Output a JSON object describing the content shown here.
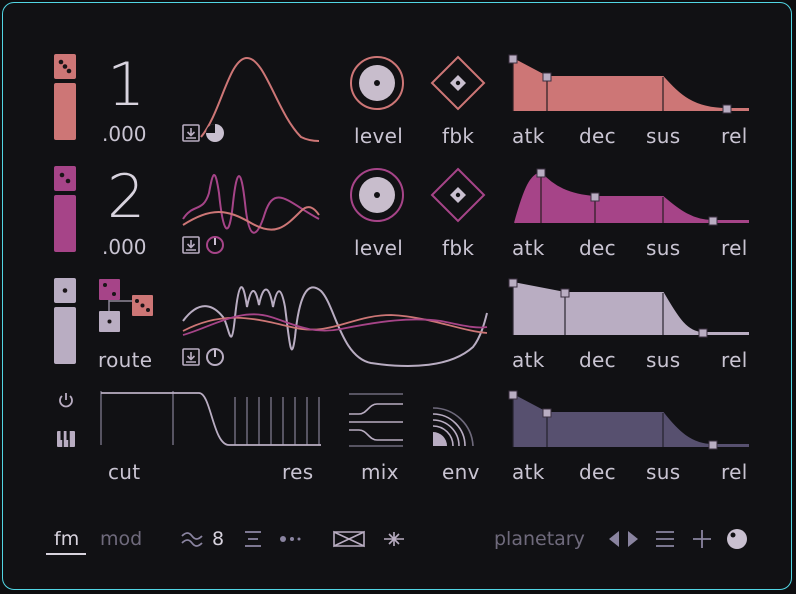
{
  "colors": {
    "osc1": "#cd7676",
    "osc2": "#a64488",
    "osc3": "#b9adc2",
    "filter_env": "#57506f",
    "accent_border": "#52d6e4",
    "text": "#c9c4d2",
    "muted": "#6f6a7c"
  },
  "operators": [
    {
      "number": "1",
      "fine": ".000",
      "level_label": "level",
      "fbk_label": "fbk",
      "env_labels": {
        "atk": "atk",
        "dec": "dec",
        "sus": "sus",
        "rel": "rel"
      }
    },
    {
      "number": "2",
      "fine": ".000",
      "level_label": "level",
      "fbk_label": "fbk",
      "env_labels": {
        "atk": "atk",
        "dec": "dec",
        "sus": "sus",
        "rel": "rel"
      }
    },
    {
      "route_label": "route",
      "env_labels": {
        "atk": "atk",
        "dec": "dec",
        "sus": "sus",
        "rel": "rel"
      }
    }
  ],
  "filter": {
    "cut_label": "cut",
    "res_label": "res",
    "mix_label": "mix",
    "env_label": "env",
    "env_labels": {
      "atk": "atk",
      "dec": "dec",
      "sus": "sus",
      "rel": "rel"
    }
  },
  "footer": {
    "tab_fm": "fm",
    "tab_mod": "mod",
    "voices": "8",
    "preset_name": "planetary"
  },
  "icons": [
    "dice-icon",
    "download-icon",
    "pie-icon",
    "power-icon",
    "piano-icon",
    "wave-approx-icon",
    "align-icon",
    "dots-icon",
    "bowtie-icon",
    "sparkle-icon",
    "arrow-left-icon",
    "arrow-right-icon",
    "menu-icon",
    "plus-icon",
    "dial-icon"
  ]
}
